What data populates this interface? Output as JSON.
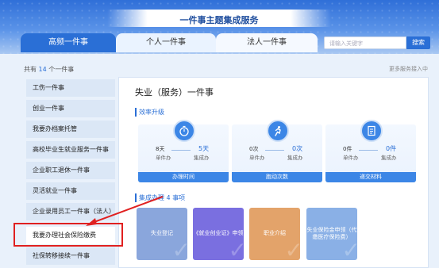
{
  "header": {
    "title": "一件事主题集成服务"
  },
  "tabs": [
    "高频一件事",
    "个人一件事",
    "法人一件事"
  ],
  "search": {
    "placeholder": "请输入关键字",
    "button": "搜索"
  },
  "list_info": {
    "prefix": "共有",
    "count": "14",
    "suffix": "个一件事",
    "more": "更多服务接入中"
  },
  "sidebar": {
    "items": [
      "工伤一件事",
      "创业一件事",
      "我要办档案托管",
      "高校毕业生就业服务一件事",
      "企业职工退休一件事",
      "灵活就业一件事",
      "企业录用员工一件事（法人）",
      "我要办理社会保险缴费",
      "社保转移接续一件事"
    ]
  },
  "panel": {
    "title": "失业（服务）一件事",
    "section1": "效率升级",
    "cards": [
      {
        "from_value": "8天",
        "from_label": "单件办",
        "to_value": "5天",
        "to_label": "集成办",
        "footer": "办理时间"
      },
      {
        "from_value": "0次",
        "from_label": "单件办",
        "to_value": "0次",
        "to_label": "集成办",
        "footer": "跑动次数"
      },
      {
        "from_value": "0件",
        "from_label": "单件办",
        "to_value": "0件",
        "to_label": "集成办",
        "footer": "递交材料"
      }
    ],
    "section2_prefix": "集成办理",
    "section2_count": "4",
    "section2_suffix": "事项",
    "tiles": [
      {
        "label": "失业登记",
        "color": "#8aa6dc"
      },
      {
        "label": "《就业创业证》申领",
        "color": "#7a6fe0"
      },
      {
        "label": "职业介绍",
        "color": "#e3a36a"
      },
      {
        "label": "失业保险金申领（代缴医疗保险费）",
        "color": "#8ab0e6"
      }
    ]
  },
  "colors": {
    "primary": "#2a6fd6",
    "annotation": "#e02020"
  }
}
